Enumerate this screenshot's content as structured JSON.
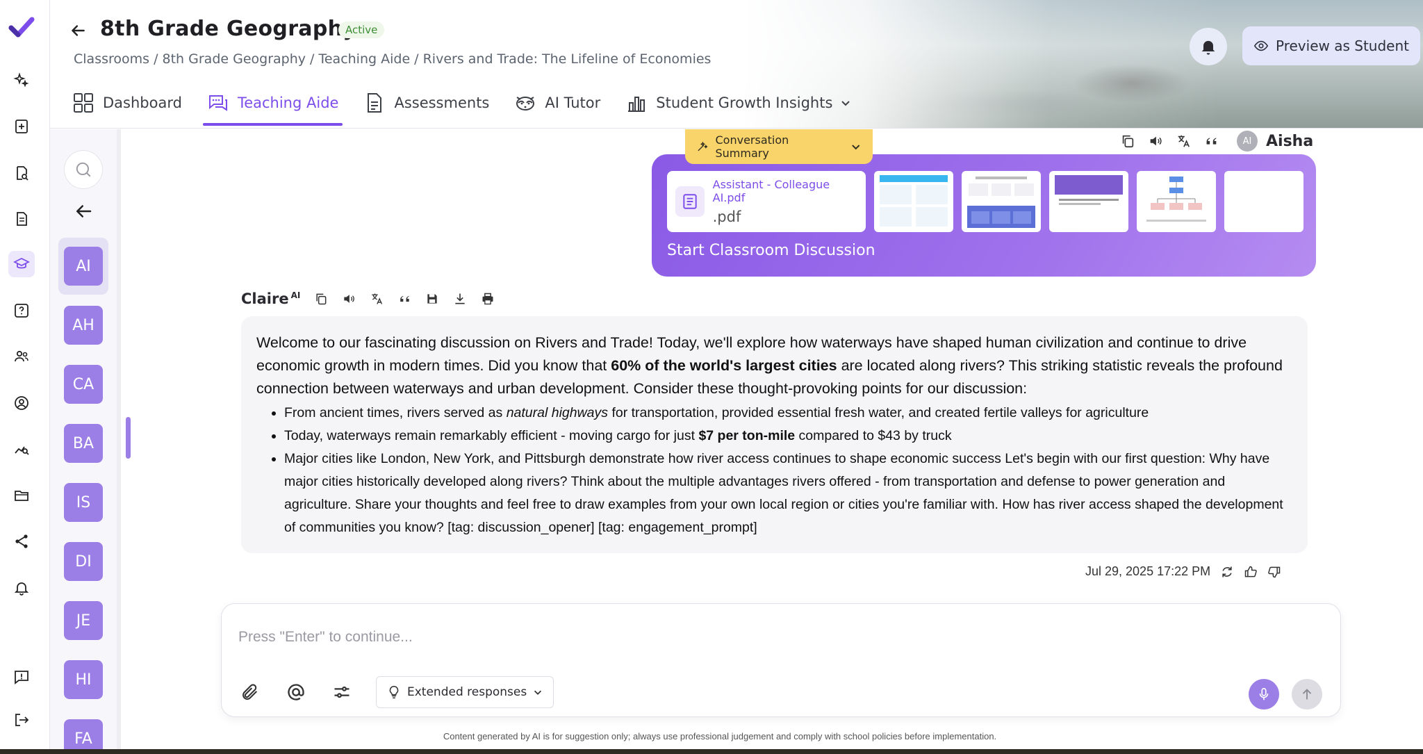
{
  "header": {
    "title": "8th Grade Geography",
    "status": "Active",
    "breadcrumb": "Classrooms / 8th Grade Geography / Teaching Aide / Rivers and Trade: The Lifeline of Economies",
    "preview_label": "Preview as Student",
    "tabs": [
      {
        "label": "Dashboard",
        "icon": "grid-icon"
      },
      {
        "label": "Teaching Aide",
        "icon": "chat-bubbles-icon",
        "active": true
      },
      {
        "label": "Assessments",
        "icon": "document-icon"
      },
      {
        "label": "AI Tutor",
        "icon": "raccoon-icon"
      },
      {
        "label": "Student Growth Insights",
        "icon": "bar-chart-icon",
        "has_dropdown": true
      }
    ]
  },
  "rail": {
    "items": [
      "sparkle-icon",
      "add-note-icon",
      "search-doc-icon",
      "document-icon",
      "graduation-cap-icon",
      "question-icon",
      "people-icon",
      "user-circle-icon",
      "analytics-icon",
      "folder-icon",
      "share-icon",
      "bell-icon",
      "feedback-icon",
      "logout-icon"
    ],
    "active_index": 4
  },
  "conversations": {
    "avatars": [
      "AI",
      "AH",
      "CA",
      "BA",
      "IS",
      "DI",
      "JE",
      "HI",
      "FA"
    ],
    "active_index": 0
  },
  "user_message": {
    "user_initials": "AI",
    "user_name": "Aisha",
    "summary_label": "Conversation Summary",
    "file_name": "Assistant - Colleague AI.pdf",
    "file_ext": ".pdf",
    "caption": "Start Classroom Discussion"
  },
  "assistant_message": {
    "name": "Claire",
    "name_badge": "AI",
    "intro_before": "Welcome to our fascinating discussion on Rivers and Trade! Today, we'll explore how waterways have shaped human civilization and continue to drive economic growth in modern times. Did you know that ",
    "intro_bold": "60% of the world's largest cities",
    "intro_after": " are located along rivers? This striking statistic reveals the profound connection between waterways and urban development. Consider these thought-provoking points for our discussion:",
    "bullet1_before": "From ancient times, rivers served as ",
    "bullet1_italic": "natural highways",
    "bullet1_after": " for transportation, provided essential fresh water, and created fertile valleys for agriculture",
    "bullet2_before": "Today, waterways remain remarkably efficient - moving cargo for just ",
    "bullet2_bold": "$7 per ton-mile",
    "bullet2_after": " compared to $43 by truck",
    "bullet3": "Major cities like London, New York, and Pittsburgh demonstrate how river access continues to shape economic success Let's begin with our first question: Why have major cities historically developed along rivers? Think about the multiple advantages rivers offered - from transportation and defense to power generation and agriculture. Share your thoughts and feel free to draw examples from your own local region or cities you're familiar with. How has river access shaped the development of communities you know? [tag: discussion_opener] [tag: engagement_prompt]",
    "timestamp": "Jul 29, 2025 17:22 PM"
  },
  "composer": {
    "placeholder": "Press \"Enter\" to continue...",
    "value": "",
    "mode_label": "Extended responses"
  },
  "disclaimer": "Content generated by AI is for suggestion only; always use professional judgement and comply with school policies before implementation.",
  "colors": {
    "accent": "#7c4dea",
    "avatar": "#9b7ee6",
    "summary": "#f9d46a",
    "status_green": "#3c8d34"
  }
}
